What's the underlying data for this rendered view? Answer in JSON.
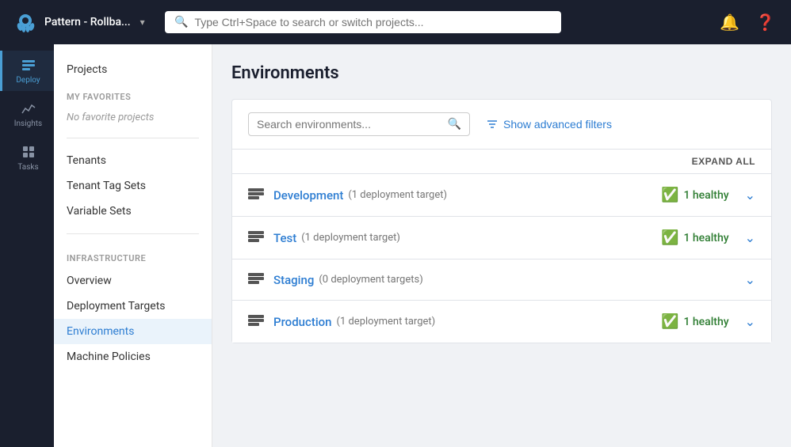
{
  "header": {
    "brand_name": "Pattern - Rollba...",
    "search_placeholder": "Type Ctrl+Space to search or switch projects...",
    "chevron": "▾"
  },
  "sidebar_icons": [
    {
      "id": "deploy",
      "label": "Deploy",
      "active": true
    },
    {
      "id": "insights",
      "label": "Insights",
      "active": false
    },
    {
      "id": "tasks",
      "label": "Tasks",
      "active": false
    }
  ],
  "sidebar_nav": {
    "top_items": [
      {
        "id": "projects",
        "label": "Projects"
      }
    ],
    "favorites_section": "MY FAVORITES",
    "favorites_empty": "No favorite projects",
    "bottom_sections": [
      {
        "items": [
          {
            "id": "tenants",
            "label": "Tenants"
          },
          {
            "id": "tenant-tag-sets",
            "label": "Tenant Tag Sets"
          },
          {
            "id": "variable-sets",
            "label": "Variable Sets"
          }
        ]
      },
      {
        "section_title": "INFRASTRUCTURE",
        "items": [
          {
            "id": "overview",
            "label": "Overview"
          },
          {
            "id": "deployment-targets",
            "label": "Deployment Targets"
          },
          {
            "id": "environments",
            "label": "Environments",
            "active": true
          },
          {
            "id": "machine-policies",
            "label": "Machine Policies"
          }
        ]
      }
    ]
  },
  "main": {
    "page_title": "Environments",
    "search_placeholder": "Search environments...",
    "advanced_filters_label": "Show advanced filters",
    "expand_all_label": "EXPAND ALL",
    "environments": [
      {
        "name": "Development",
        "count_text": "(1 deployment target)",
        "status": "1 healthy",
        "has_status": true
      },
      {
        "name": "Test",
        "count_text": "(1 deployment target)",
        "status": "1 healthy",
        "has_status": true
      },
      {
        "name": "Staging",
        "count_text": "(0 deployment targets)",
        "status": "",
        "has_status": false
      },
      {
        "name": "Production",
        "count_text": "(1 deployment target)",
        "status": "1 healthy",
        "has_status": true
      }
    ]
  }
}
